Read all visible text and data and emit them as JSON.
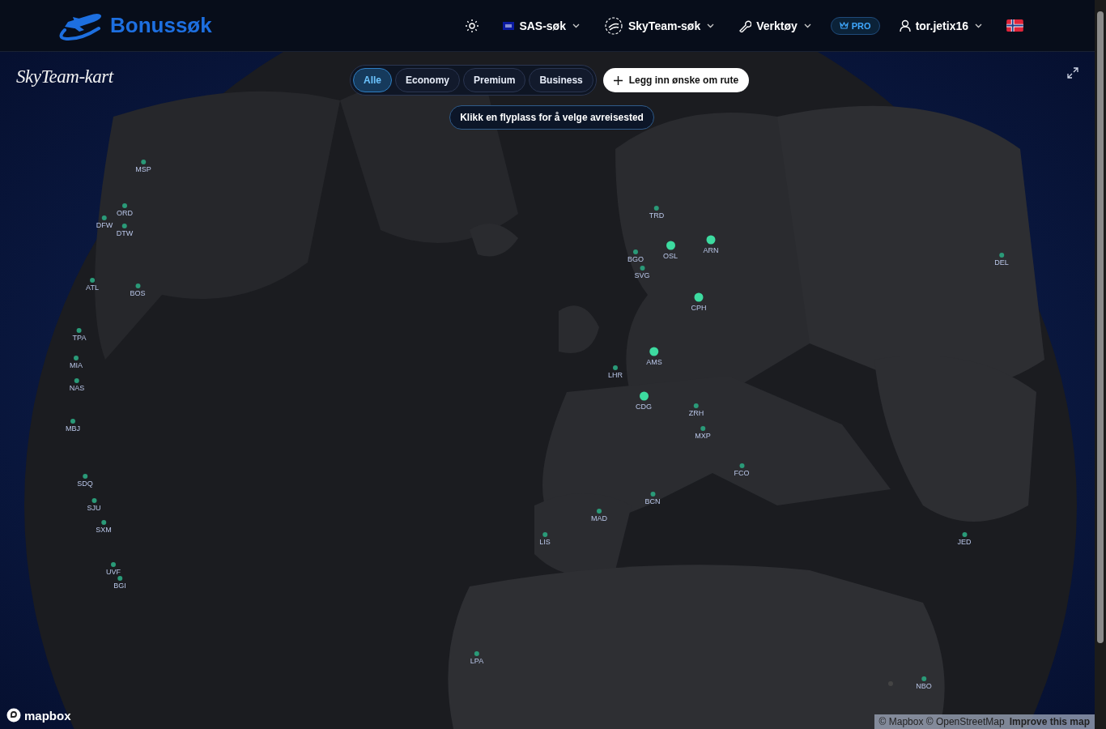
{
  "header": {
    "brand": "Bonussøk",
    "nav": [
      {
        "label": "SAS-søk"
      },
      {
        "label": "SkyTeam-søk"
      },
      {
        "label": "Verktøy"
      }
    ],
    "badge": "PRO",
    "user": "tor.jetix16"
  },
  "map": {
    "title": "SkyTeam-kart",
    "filters": [
      {
        "label": "Alle",
        "selected": true
      },
      {
        "label": "Economy",
        "selected": false
      },
      {
        "label": "Premium",
        "selected": false
      },
      {
        "label": "Business",
        "selected": false
      }
    ],
    "add_button": "Legg inn ønske om rute",
    "hint": "Klikk en flyplass for å velge avreisested",
    "airports": [
      {
        "code": "MSP",
        "kind": "minor"
      },
      {
        "code": "ORD",
        "kind": "minor"
      },
      {
        "code": "DFW",
        "kind": "minor"
      },
      {
        "code": "DTW",
        "kind": "minor"
      },
      {
        "code": "ATL",
        "kind": "minor"
      },
      {
        "code": "BOS",
        "kind": "minor"
      },
      {
        "code": "TPA",
        "kind": "minor"
      },
      {
        "code": "MIA",
        "kind": "minor"
      },
      {
        "code": "NAS",
        "kind": "minor"
      },
      {
        "code": "MBJ",
        "kind": "minor"
      },
      {
        "code": "SDQ",
        "kind": "minor"
      },
      {
        "code": "SJU",
        "kind": "minor"
      },
      {
        "code": "SXM",
        "kind": "minor"
      },
      {
        "code": "UVF",
        "kind": "minor"
      },
      {
        "code": "BGI",
        "kind": "minor"
      },
      {
        "code": "TRD",
        "kind": "minor"
      },
      {
        "code": "OSL",
        "kind": "major"
      },
      {
        "code": "ARN",
        "kind": "major"
      },
      {
        "code": "BGO",
        "kind": "minor"
      },
      {
        "code": "SVG",
        "kind": "minor"
      },
      {
        "code": "CPH",
        "kind": "major"
      },
      {
        "code": "AMS",
        "kind": "major"
      },
      {
        "code": "LHR",
        "kind": "minor"
      },
      {
        "code": "CDG",
        "kind": "major"
      },
      {
        "code": "ZRH",
        "kind": "minor"
      },
      {
        "code": "MXP",
        "kind": "minor"
      },
      {
        "code": "FCO",
        "kind": "minor"
      },
      {
        "code": "BCN",
        "kind": "minor"
      },
      {
        "code": "MAD",
        "kind": "minor"
      },
      {
        "code": "LIS",
        "kind": "minor"
      },
      {
        "code": "LPA",
        "kind": "minor"
      },
      {
        "code": "DEL",
        "kind": "minor"
      },
      {
        "code": "JED",
        "kind": "minor"
      },
      {
        "code": "NBO",
        "kind": "minor"
      }
    ],
    "logo": "mapbox",
    "attribution": "© Mapbox © OpenStreetMap",
    "improve_link": "Improve this map"
  }
}
